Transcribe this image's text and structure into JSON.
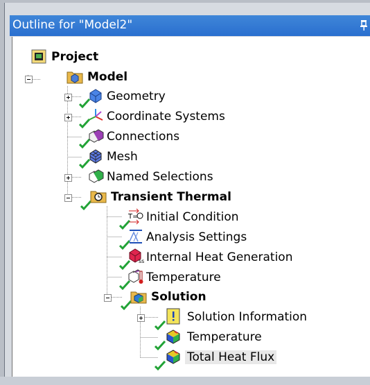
{
  "window": {
    "title": "Outline for \"Model2\"",
    "pin_icon": "pin-icon"
  },
  "tree": {
    "project": "Project",
    "model": "Model",
    "geometry": "Geometry",
    "coordinate_systems": "Coordinate Systems",
    "connections": "Connections",
    "mesh": "Mesh",
    "named_selections": "Named Selections",
    "transient_thermal": "Transient Thermal",
    "initial_condition": "Initial Condition",
    "analysis_settings": "Analysis Settings",
    "internal_heat_generation": "Internal Heat Generation",
    "temperature_load": "Temperature",
    "solution": "Solution",
    "solution_information": "Solution Information",
    "temperature_result": "Temperature",
    "total_heat_flux": "Total Heat Flux"
  },
  "colors": {
    "titlebar": "#2a6fcf",
    "check": "#22a336",
    "folder": "#e9b84a"
  }
}
